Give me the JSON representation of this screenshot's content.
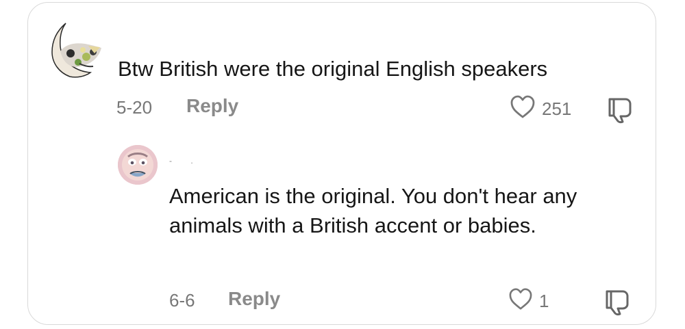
{
  "comments": {
    "main": {
      "text": "Btw British were the original English speakers",
      "date": "5-20",
      "reply_label": "Reply",
      "like_count": "251"
    },
    "reply": {
      "username": "- .",
      "text": "American is the original. You don't hear any animals with a British accent or babies.",
      "date": "6-6",
      "reply_label": "Reply",
      "like_count": "1"
    }
  },
  "icons": {
    "like": "heart-icon",
    "dislike": "thumbs-down-icon"
  },
  "colors": {
    "text": "#161616",
    "muted": "#777777",
    "border": "#d9d9d9"
  }
}
